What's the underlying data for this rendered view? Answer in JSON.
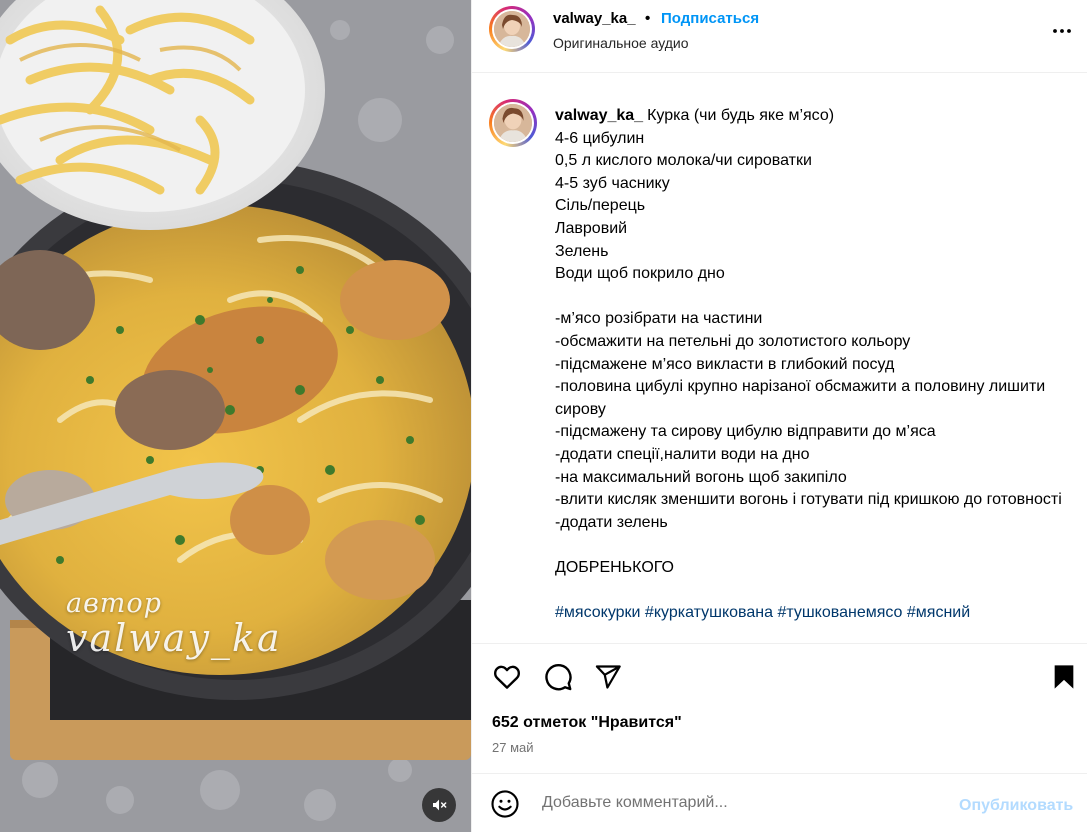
{
  "post": {
    "username": "valway_ka_",
    "separator": "•",
    "follow_label": "Подписаться",
    "audio_label": "Оригинальное аудио"
  },
  "media": {
    "watermark_line1": "автор",
    "watermark_line2": "valway_ka"
  },
  "caption": {
    "username": "valway_ka_",
    "lines": [
      "Курка (чи будь яке м’ясо)",
      "4-6 цибулин",
      "0,5 л кислого молока/чи сироватки",
      "4-5 зуб часнику",
      "Сіль/перець",
      "Лавровий",
      "Зелень",
      "Води щоб покрило дно",
      "",
      "-м’ясо розібрати на частини",
      "-обсмажити на петельні до золотистого кольору",
      "-підсмажене м’ясо викласти в глибокий посуд",
      "-половина цибулі крупно нарізаної обсмажити а половину лишити сирову",
      "-підсмажену та сирову цибулю відправити до м’яса",
      "-додати спеції,налити води на дно",
      "-на максимальний вогонь щоб закипіло",
      "-влити кисляк зменшити вогонь і готувати під кришкою до готовності",
      "-додати зелень",
      "",
      "ДОБРЕНЬКОГО",
      ""
    ],
    "hashtags": "#мясокурки #куркатушкована #тушкованемясо #мясний"
  },
  "actions": {
    "likes": "652 отметок \"Нравится\"",
    "date": "27 май"
  },
  "comment": {
    "placeholder": "Добавьте комментарий...",
    "publish_label": "Опубликовать"
  },
  "icons": {
    "more": "more-options-icon",
    "like": "heart-icon",
    "comment": "comment-icon",
    "share": "share-icon",
    "save": "bookmark-icon",
    "emoji": "emoji-icon",
    "mute": "speaker-muted-icon"
  },
  "colors": {
    "link": "#0095f6",
    "hashtag": "#00376b",
    "publish_disabled": "#b3dbff"
  }
}
